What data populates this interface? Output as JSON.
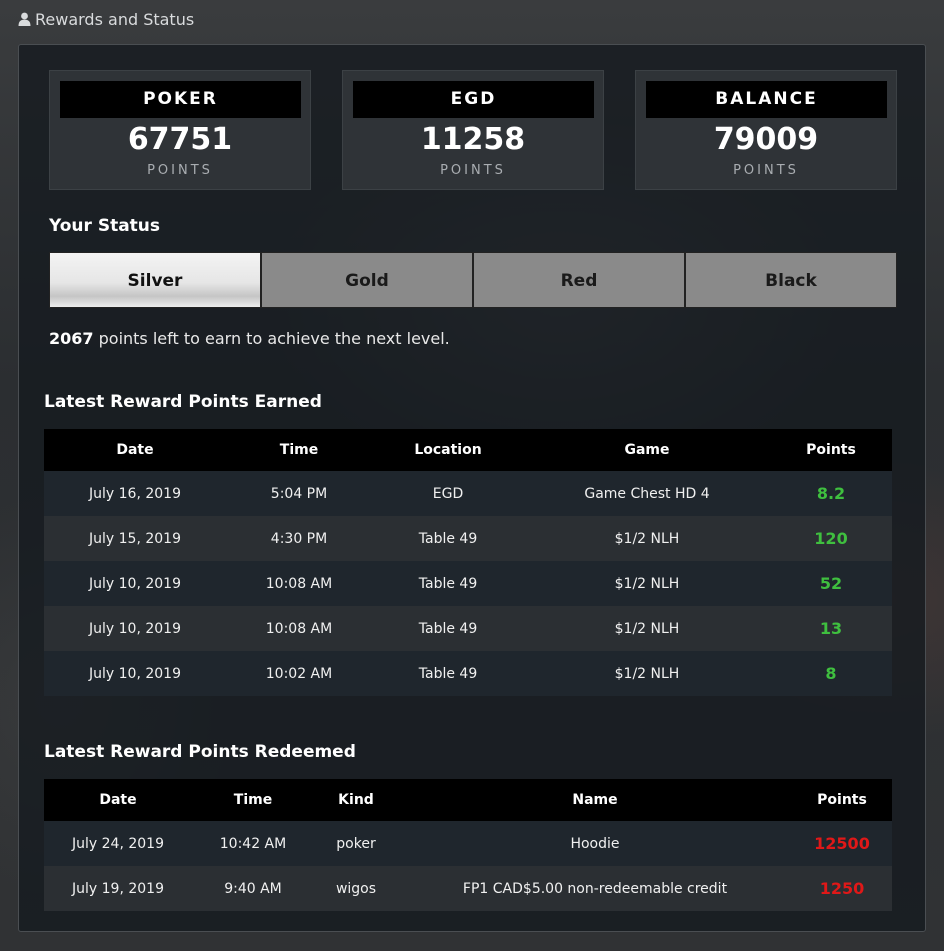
{
  "header": {
    "title": "Rewards and Status",
    "icon": "user-icon"
  },
  "cards": [
    {
      "label": "POKER",
      "value": "67751",
      "unit": "POINTS"
    },
    {
      "label": "EGD",
      "value": "11258",
      "unit": "POINTS"
    },
    {
      "label": "BALANCE",
      "value": "79009",
      "unit": "POINTS"
    }
  ],
  "status": {
    "heading": "Your Status",
    "tiers": [
      "Silver",
      "Gold",
      "Red",
      "Black"
    ],
    "active_tier": "Silver",
    "points_needed": "2067",
    "points_needed_text": " points left to earn to achieve the next level."
  },
  "earned": {
    "title": "Latest Reward Points Earned",
    "columns": [
      "Date",
      "Time",
      "Location",
      "Game",
      "Points"
    ],
    "rows": [
      [
        "July 16, 2019",
        "5:04 PM",
        "EGD",
        "Game Chest HD 4",
        "8.2"
      ],
      [
        "July 15, 2019",
        "4:30 PM",
        "Table 49",
        "$1/2 NLH",
        "120"
      ],
      [
        "July 10, 2019",
        "10:08 AM",
        "Table 49",
        "$1/2 NLH",
        "52"
      ],
      [
        "July 10, 2019",
        "10:08 AM",
        "Table 49",
        "$1/2 NLH",
        "13"
      ],
      [
        "July 10, 2019",
        "10:02 AM",
        "Table 49",
        "$1/2 NLH",
        "8"
      ]
    ]
  },
  "redeemed": {
    "title": "Latest Reward Points Redeemed",
    "columns": [
      "Date",
      "Time",
      "Kind",
      "Name",
      "Points"
    ],
    "rows": [
      [
        "July 24, 2019",
        "10:42 AM",
        "poker",
        "Hoodie",
        "12500"
      ],
      [
        "July 19, 2019",
        "9:40 AM",
        "wigos",
        "FP1 CAD$5.00 non-redeemable credit",
        "1250"
      ]
    ]
  },
  "colors": {
    "earned_points": "#3fbf3f",
    "redeemed_points": "#e01818",
    "card_header": "#000000"
  }
}
